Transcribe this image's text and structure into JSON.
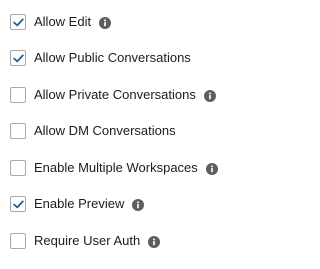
{
  "options": [
    {
      "label": "Allow Edit",
      "checked": true,
      "info_icon": "info-icon"
    },
    {
      "label": "Allow Public Conversations",
      "checked": true,
      "info_icon": null
    },
    {
      "label": "Allow Private Conversations",
      "checked": false,
      "info_icon": "info-icon"
    },
    {
      "label": "Allow DM Conversations",
      "checked": false,
      "info_icon": null
    },
    {
      "label": "Enable Multiple Workspaces",
      "checked": false,
      "info_icon": "info-icon"
    },
    {
      "label": "Enable Preview",
      "checked": true,
      "info_icon": "info-icon"
    },
    {
      "label": "Require User Auth",
      "checked": false,
      "info_icon": "info-icon"
    }
  ],
  "colors": {
    "checkmark": "#1264a3",
    "checkbox_border": "#a9a9a9",
    "label_text": "#1d1c1d",
    "info_icon": "#5e5e5e"
  }
}
